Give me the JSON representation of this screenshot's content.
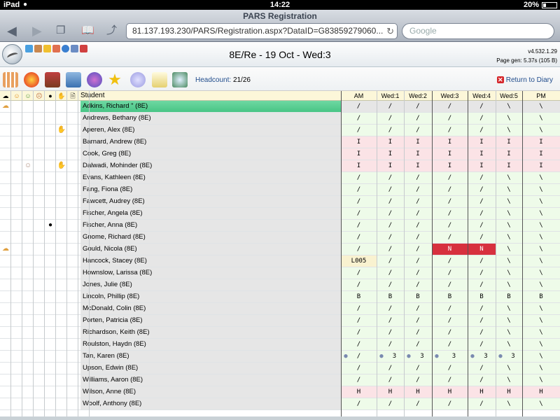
{
  "status": {
    "device": "iPad",
    "time": "14:22",
    "battery": "20%"
  },
  "safari": {
    "title": "PARS Registration",
    "url": "81.137.193.230/PARS/Registration.aspx?DataID=G83859279060...",
    "search_placeholder": "Google"
  },
  "header": {
    "lesson": "8E/Re - 19 Oct - Wed:3",
    "version": "v4.532.1.29",
    "page_gen": "Page gen: 5.37s (105 B)"
  },
  "toolbar": {
    "headcount_label": "Headcount:",
    "headcount_value": "21/26",
    "return_label": "Return to Diary"
  },
  "columns": {
    "student": "Student",
    "periods": [
      "AM",
      "Wed:1",
      "Wed:2",
      "Wed:3",
      "Wed:4",
      "Wed:5",
      "PM"
    ]
  },
  "colors": {
    "selected_row": "#5fd19a",
    "absent_red": "#d7303e",
    "present_green": "#eefbe9",
    "authorised_pink": "#fbe3e6"
  },
  "students": [
    {
      "name": "Adkins, Richard \" (8E)",
      "marks": [
        "/",
        "/",
        "/",
        "/",
        "/",
        "\\",
        "\\"
      ],
      "icon1": "weather-icon",
      "icon5": "",
      "selected": true
    },
    {
      "name": "Andrews, Bethany (8E)",
      "marks": [
        "/",
        "/",
        "/",
        "/",
        "/",
        "\\",
        "\\"
      ],
      "icon1": "",
      "icon5": ""
    },
    {
      "name": "Aperen, Alex (8E)",
      "marks": [
        "/",
        "/",
        "/",
        "/",
        "/",
        "\\",
        "\\"
      ],
      "icon1": "",
      "icon5": "hand-icon"
    },
    {
      "name": "Barnard, Andrew (8E)",
      "marks": [
        "I",
        "I",
        "I",
        "I",
        "I",
        "I",
        "I"
      ],
      "icon1": "",
      "icon5": ""
    },
    {
      "name": "Cook, Greg (8E)",
      "marks": [
        "I",
        "I",
        "I",
        "I",
        "I",
        "I",
        "I"
      ],
      "icon1": "",
      "icon5": ""
    },
    {
      "name": "Dalwadi, Mohinder (8E)",
      "marks": [
        "I",
        "I",
        "I",
        "I",
        "I",
        "I",
        "I"
      ],
      "icon1": "",
      "icon3": "face-icon",
      "icon5": "hand-icon"
    },
    {
      "name": "Evans, Kathleen (8E)",
      "marks": [
        "/",
        "/",
        "/",
        "/",
        "/",
        "\\",
        "\\"
      ],
      "icon1": "",
      "icon5": ""
    },
    {
      "name": "Fang, Fiona (8E)",
      "marks": [
        "/",
        "/",
        "/",
        "/",
        "/",
        "\\",
        "\\"
      ],
      "icon1": "",
      "icon5": ""
    },
    {
      "name": "Fawcett, Audrey (8E)",
      "marks": [
        "/",
        "/",
        "/",
        "/",
        "/",
        "\\",
        "\\"
      ],
      "icon1": "",
      "icon5": ""
    },
    {
      "name": "Fischer, Angela (8E)",
      "marks": [
        "/",
        "/",
        "/",
        "/",
        "/",
        "\\",
        "\\"
      ],
      "icon1": "",
      "icon5": ""
    },
    {
      "name": "Fischer, Anna (8E)",
      "marks": [
        "/",
        "/",
        "/",
        "/",
        "/",
        "\\",
        "\\"
      ],
      "icon1": "",
      "icon4": "paw-icon",
      "icon5": ""
    },
    {
      "name": "Gnome, Richard (8E)",
      "marks": [
        "/",
        "/",
        "/",
        "/",
        "/",
        "\\",
        "\\"
      ],
      "icon1": "",
      "icon5": ""
    },
    {
      "name": "Gould, Nicola (8E)",
      "marks": [
        "/",
        "/",
        "/",
        "N",
        "N",
        "\\",
        "\\"
      ],
      "icon1": "weather-icon",
      "icon5": ""
    },
    {
      "name": "Hancock, Stacey (8E)",
      "marks": [
        "L005",
        "/",
        "/",
        "/",
        "/",
        "\\",
        "\\"
      ],
      "icon1": "",
      "icon5": ""
    },
    {
      "name": "Hownslow, Larissa (8E)",
      "marks": [
        "/",
        "/",
        "/",
        "/",
        "/",
        "\\",
        "\\"
      ],
      "icon1": "",
      "icon5": ""
    },
    {
      "name": "Jones, Julie (8E)",
      "marks": [
        "/",
        "/",
        "/",
        "/",
        "/",
        "\\",
        "\\"
      ],
      "icon1": "",
      "icon5": ""
    },
    {
      "name": "Lincoln, Phillip (8E)",
      "marks": [
        "B",
        "B",
        "B",
        "B",
        "B",
        "B",
        "B"
      ],
      "icon1": "",
      "icon5": ""
    },
    {
      "name": "McDonald, Colin (8E)",
      "marks": [
        "/",
        "/",
        "/",
        "/",
        "/",
        "\\",
        "\\"
      ],
      "icon1": "",
      "icon5": ""
    },
    {
      "name": "Porten, Patricia (8E)",
      "marks": [
        "/",
        "/",
        "/",
        "/",
        "/",
        "\\",
        "\\"
      ],
      "icon1": "",
      "icon5": ""
    },
    {
      "name": "Richardson, Keith (8E)",
      "marks": [
        "/",
        "/",
        "/",
        "/",
        "/",
        "\\",
        "\\"
      ],
      "icon1": "",
      "icon5": ""
    },
    {
      "name": "Roulston, Haydn (8E)",
      "marks": [
        "/",
        "/",
        "/",
        "/",
        "/",
        "\\",
        "\\"
      ],
      "icon1": "",
      "icon5": ""
    },
    {
      "name": "Tan, Karen (8E)",
      "marks": [
        "/",
        "3",
        "3",
        "3",
        "3",
        "3",
        "\\"
      ],
      "icon1": "",
      "icon5": "",
      "chat": true
    },
    {
      "name": "Upson, Edwin (8E)",
      "marks": [
        "/",
        "/",
        "/",
        "/",
        "/",
        "\\",
        "\\"
      ],
      "icon1": "",
      "icon5": ""
    },
    {
      "name": "Williams, Aaron (8E)",
      "marks": [
        "/",
        "/",
        "/",
        "/",
        "/",
        "\\",
        "\\"
      ],
      "icon1": "",
      "icon5": ""
    },
    {
      "name": "Wilson, Anne (8E)",
      "marks": [
        "H",
        "H",
        "H",
        "H",
        "H",
        "H",
        "H"
      ],
      "icon1": "",
      "icon5": ""
    },
    {
      "name": "Woolf, Anthony (8E)",
      "marks": [
        "/",
        "/",
        "/",
        "/",
        "/",
        "\\",
        "\\"
      ],
      "icon1": "",
      "icon5": ""
    }
  ]
}
